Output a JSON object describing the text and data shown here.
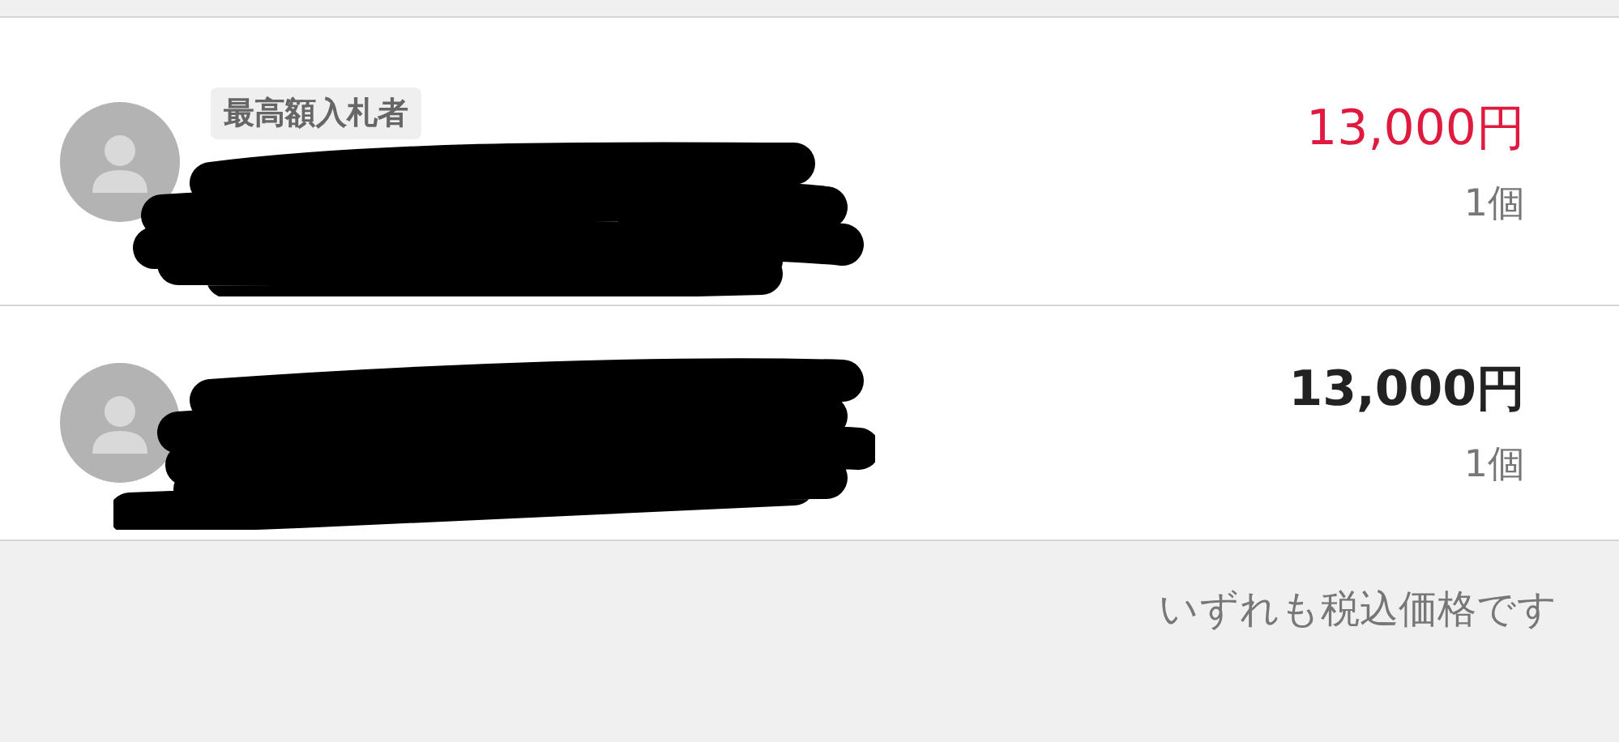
{
  "bids": [
    {
      "badge": "最高額入札者",
      "highlighted": true,
      "price": "13,000円",
      "quantity": "1個"
    },
    {
      "highlighted": false,
      "price": "13,000円",
      "quantity": "1個"
    }
  ],
  "footer_note": "いずれも税込価格です"
}
